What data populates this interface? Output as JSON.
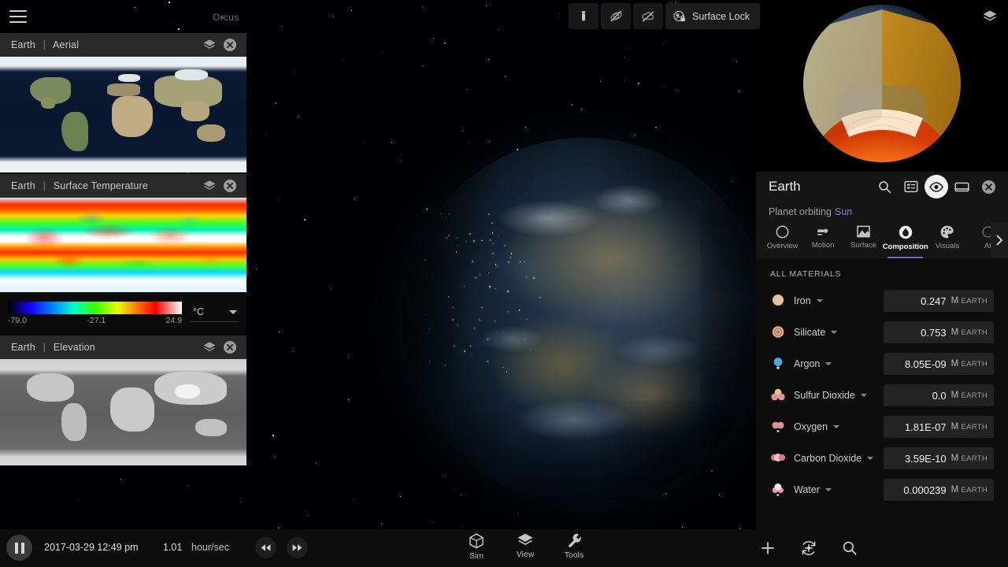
{
  "app": {
    "top_label": "Orcus"
  },
  "top_tools": {
    "flashlight_title": "flashlight",
    "orbits_title": "orbits-off",
    "clouds_title": "clouds-off",
    "surface_lock_label": "Surface Lock"
  },
  "map_panels": [
    {
      "body": "Earth",
      "sep": "|",
      "layer": "Aerial"
    },
    {
      "body": "Earth",
      "sep": "|",
      "layer": "Surface Temperature"
    },
    {
      "body": "Earth",
      "sep": "|",
      "layer": "Elevation"
    }
  ],
  "legend": {
    "min": "-79.0",
    "mid": "-27.1",
    "max": "24.9",
    "unit": "°C"
  },
  "detail": {
    "title": "Earth",
    "subtitle_prefix": "Planet orbiting",
    "parent": "Sun",
    "header_icons": [
      "search-icon",
      "details-icon",
      "visibility-icon",
      "window-icon",
      "close-icon"
    ],
    "tabs": [
      {
        "label": "Overview",
        "icon": "circle-icon",
        "selected": false
      },
      {
        "label": "Motion",
        "icon": "motion-icon",
        "selected": false
      },
      {
        "label": "Surface",
        "icon": "surface-icon",
        "selected": false
      },
      {
        "label": "Composition",
        "icon": "composition-icon",
        "selected": true
      },
      {
        "label": "Visuals",
        "icon": "palette-icon",
        "selected": false
      },
      {
        "label": "At",
        "icon": "atmosphere-icon",
        "selected": false
      }
    ],
    "section_label": "ALL MATERIALS",
    "unit_label_m": "M",
    "unit_label_earth": "EARTH",
    "materials": [
      {
        "name": "Iron",
        "value": "0.247",
        "color": "#e7bfa2",
        "style": "sphere"
      },
      {
        "name": "Silicate",
        "value": "0.753",
        "color": "#dba98f",
        "style": "cluster"
      },
      {
        "name": "Argon",
        "value": "8.05E-09",
        "color": "#4aa8d8",
        "style": "single"
      },
      {
        "name": "Sulfur Dioxide",
        "value": "0.0",
        "color": "#e4c87a",
        "style": "tri"
      },
      {
        "name": "Oxygen",
        "value": "1.81E-07",
        "color": "#e08d94",
        "style": "pair"
      },
      {
        "name": "Carbon Dioxide",
        "value": "3.59E-10",
        "color": "#d98a90",
        "style": "triple"
      },
      {
        "name": "Water",
        "value": "0.000239",
        "color": "#e9939b",
        "style": "water"
      }
    ]
  },
  "timebar": {
    "play_state": "pause",
    "date": "2017-03-29 12:49 pm",
    "rate_value": "1.01",
    "rate_unit": "hour/sec"
  },
  "modes": [
    {
      "label": "Sim",
      "icon": "cube-icon"
    },
    {
      "label": "View",
      "icon": "layers-icon"
    },
    {
      "label": "Tools",
      "icon": "wrench-icon"
    }
  ],
  "bottom_right": [
    {
      "icon": "plus-icon"
    },
    {
      "icon": "recenter-icon"
    },
    {
      "icon": "search-icon"
    }
  ],
  "colors": {
    "accent": "#7c5fd3",
    "link": "#8e7bd6",
    "panel_bg": "#151515",
    "header_bg": "#2a2a2a"
  }
}
